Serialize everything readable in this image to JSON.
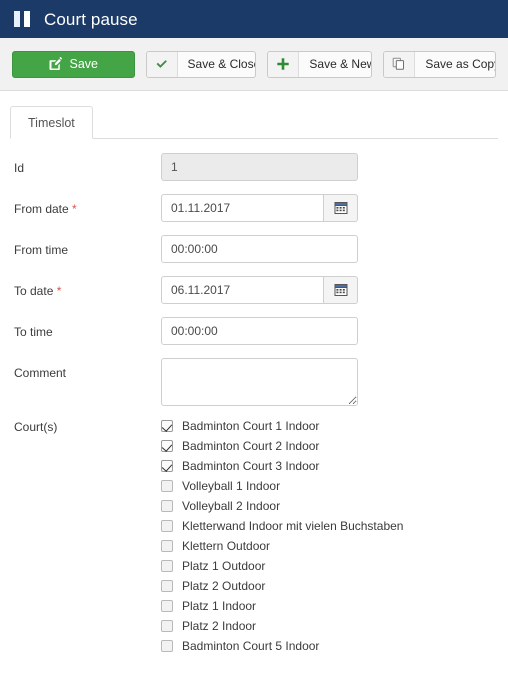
{
  "window": {
    "icon": "pause-icon",
    "title": "Court pause",
    "header_color": "#1b3a67"
  },
  "toolbar": {
    "buttons": [
      {
        "label": "Save",
        "icon": "edit-square-icon",
        "primary": true,
        "accent": "#44a546"
      },
      {
        "label": "Save & Close",
        "icon": "check-icon",
        "primary": false
      },
      {
        "label": "Save & New",
        "icon": "plus-icon",
        "primary": false
      },
      {
        "label": "Save as Copy",
        "icon": "copy-icon",
        "primary": false
      }
    ]
  },
  "tabs": [
    {
      "label": "Timeslot",
      "active": true
    }
  ],
  "form": {
    "fields": [
      {
        "label": "Id",
        "required": false,
        "value": "1",
        "placeholder": "",
        "type": "text",
        "readonly": true,
        "calendar": false
      },
      {
        "label": "From date",
        "required": true,
        "value": "01.11.2017",
        "placeholder": "",
        "type": "text",
        "readonly": false,
        "calendar": true
      },
      {
        "label": "From time",
        "required": false,
        "value": "00:00:00",
        "placeholder": "",
        "type": "text",
        "readonly": false,
        "calendar": false
      },
      {
        "label": "To date",
        "required": true,
        "value": "06.11.2017",
        "placeholder": "",
        "type": "text",
        "readonly": false,
        "calendar": true
      },
      {
        "label": "To time",
        "required": false,
        "value": "00:00:00",
        "placeholder": "",
        "type": "text",
        "readonly": false,
        "calendar": false
      },
      {
        "label": "Comment",
        "required": false,
        "value": "",
        "placeholder": "",
        "type": "textarea",
        "readonly": false,
        "calendar": false
      }
    ],
    "required_marker": "*",
    "courts": {
      "label": "Court(s)",
      "items": [
        {
          "label": "Badminton Court 1 Indoor",
          "checked": true
        },
        {
          "label": "Badminton Court 2 Indoor",
          "checked": true
        },
        {
          "label": "Badminton Court 3 Indoor",
          "checked": true
        },
        {
          "label": "Volleyball 1 Indoor",
          "checked": false
        },
        {
          "label": "Volleyball 2 Indoor",
          "checked": false
        },
        {
          "label": "Kletterwand Indoor mit vielen Buchstaben",
          "checked": false
        },
        {
          "label": "Klettern Outdoor",
          "checked": false
        },
        {
          "label": "Platz 1 Outdoor",
          "checked": false
        },
        {
          "label": "Platz 2 Outdoor",
          "checked": false
        },
        {
          "label": "Platz 1 Indoor",
          "checked": false
        },
        {
          "label": "Platz 2 Indoor",
          "checked": false
        },
        {
          "label": "Badminton Court 5 Indoor",
          "checked": false
        }
      ]
    }
  }
}
